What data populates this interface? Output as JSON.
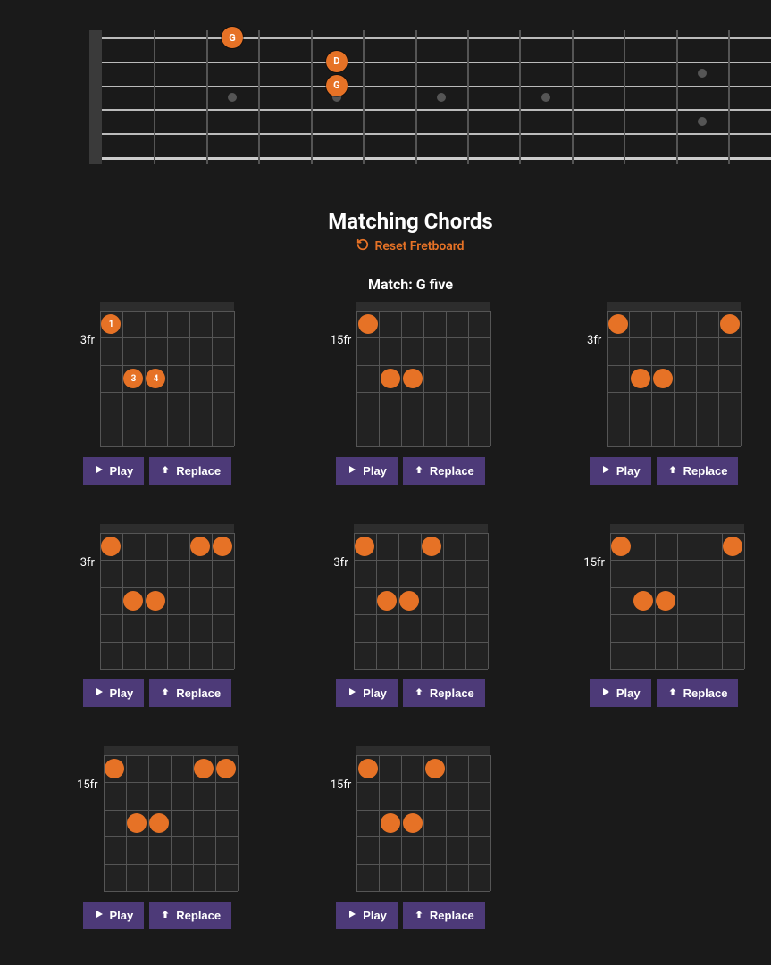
{
  "colors": {
    "accent": "#e67226",
    "button": "#4d3a78",
    "bg": "#1a1a1a"
  },
  "fretboard": {
    "strings": 6,
    "frets": 12,
    "markers_frets": [
      3,
      5,
      7,
      9,
      12
    ],
    "notes": [
      {
        "string": 6,
        "fret": 3,
        "label": "G"
      },
      {
        "string": 5,
        "fret": 5,
        "label": "D"
      },
      {
        "string": 4,
        "fret": 5,
        "label": "G"
      }
    ]
  },
  "heading": {
    "title": "Matching Chords",
    "reset_label": "Reset Fretboard"
  },
  "match_line": {
    "prefix": "Match: ",
    "name": "G five"
  },
  "buttons": {
    "play": "Play",
    "replace": "Replace"
  },
  "cards": [
    {
      "start_fret": "3fr",
      "dots": [
        {
          "s": 1,
          "f": 1,
          "t": "1"
        },
        {
          "s": 2,
          "f": 3,
          "t": "3"
        },
        {
          "s": 3,
          "f": 3,
          "t": "4"
        }
      ]
    },
    {
      "start_fret": "15fr",
      "dots": [
        {
          "s": 1,
          "f": 1
        },
        {
          "s": 2,
          "f": 3
        },
        {
          "s": 3,
          "f": 3
        }
      ]
    },
    {
      "start_fret": "3fr",
      "dots": [
        {
          "s": 1,
          "f": 1
        },
        {
          "s": 6,
          "f": 1
        },
        {
          "s": 2,
          "f": 3
        },
        {
          "s": 3,
          "f": 3
        }
      ]
    },
    {
      "start_fret": "3fr",
      "dots": [
        {
          "s": 1,
          "f": 1
        },
        {
          "s": 5,
          "f": 1
        },
        {
          "s": 6,
          "f": 1
        },
        {
          "s": 2,
          "f": 3
        },
        {
          "s": 3,
          "f": 3
        }
      ]
    },
    {
      "start_fret": "3fr",
      "dots": [
        {
          "s": 1,
          "f": 1
        },
        {
          "s": 4,
          "f": 1
        },
        {
          "s": 2,
          "f": 3
        },
        {
          "s": 3,
          "f": 3
        }
      ]
    },
    {
      "start_fret": "15fr",
      "dots": [
        {
          "s": 1,
          "f": 1
        },
        {
          "s": 6,
          "f": 1
        },
        {
          "s": 2,
          "f": 3
        },
        {
          "s": 3,
          "f": 3
        }
      ]
    },
    {
      "start_fret": "15fr",
      "dots": [
        {
          "s": 1,
          "f": 1
        },
        {
          "s": 5,
          "f": 1
        },
        {
          "s": 6,
          "f": 1
        },
        {
          "s": 2,
          "f": 3
        },
        {
          "s": 3,
          "f": 3
        }
      ]
    },
    {
      "start_fret": "15fr",
      "dots": [
        {
          "s": 1,
          "f": 1
        },
        {
          "s": 4,
          "f": 1
        },
        {
          "s": 2,
          "f": 3
        },
        {
          "s": 3,
          "f": 3
        }
      ]
    }
  ]
}
